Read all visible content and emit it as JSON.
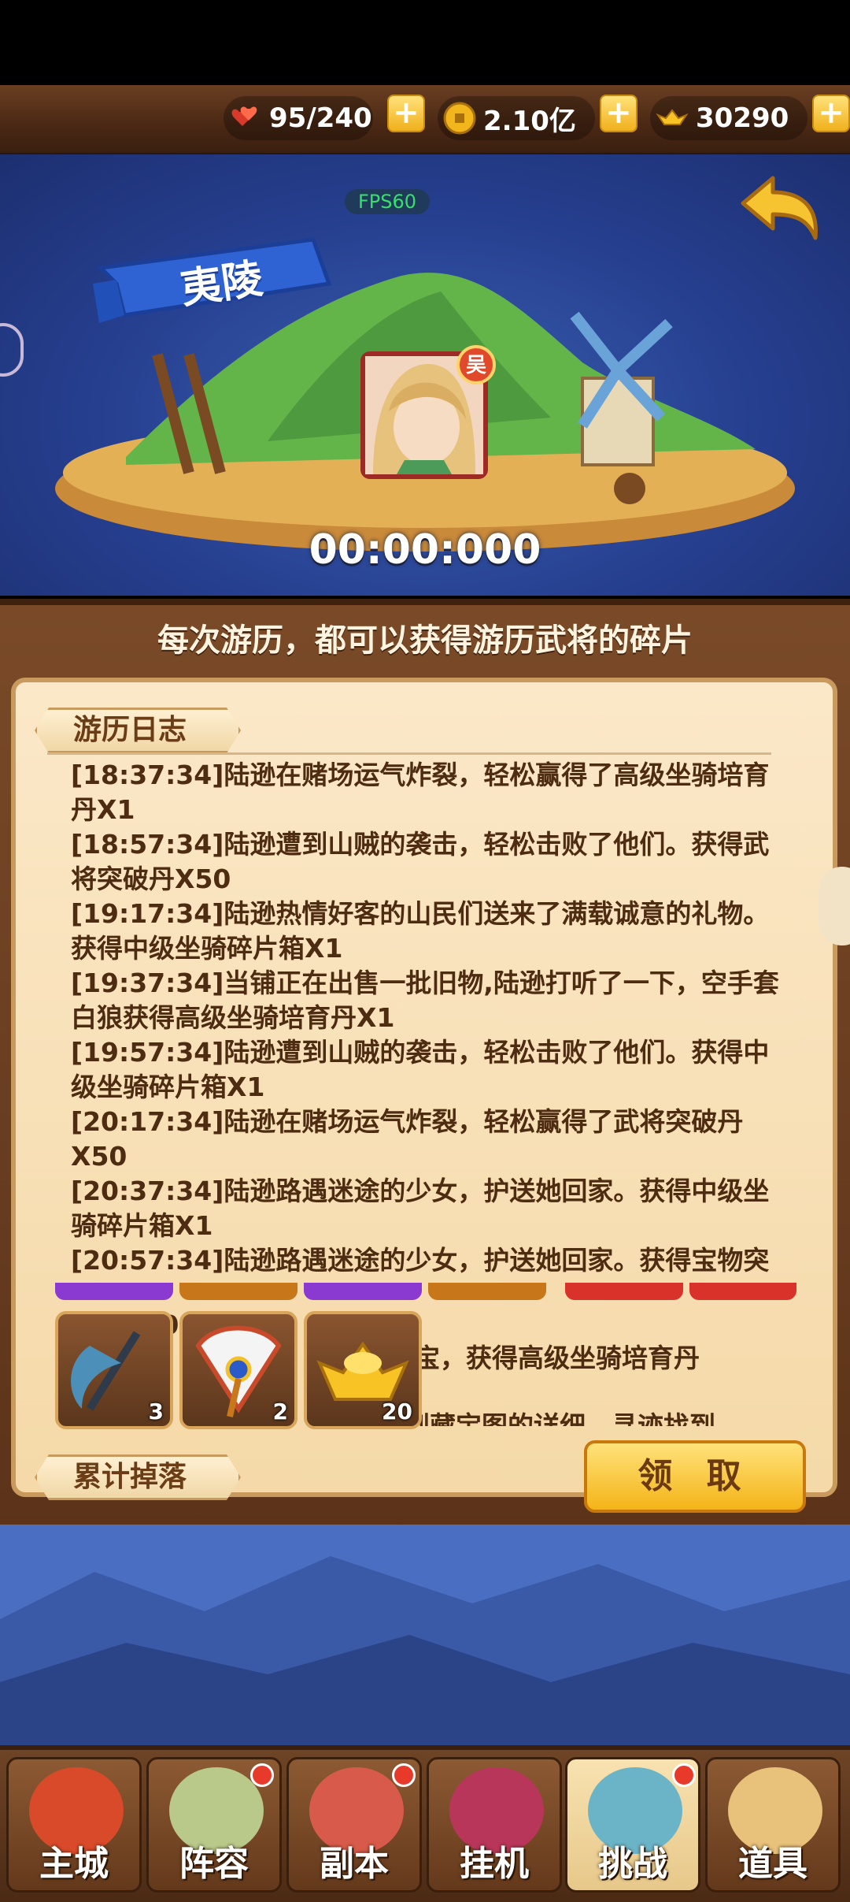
{
  "resources": {
    "stamina": {
      "icon": "hearts-icon",
      "value": "95/240"
    },
    "coins": {
      "icon": "coin-icon",
      "value": "2.10亿"
    },
    "gold": {
      "icon": "ingot-icon",
      "value": "30290"
    }
  },
  "scene": {
    "fps": "FPS60",
    "location": "夷陵",
    "hero_badge": "吴",
    "timer": "00:00:000"
  },
  "panel": {
    "header": "每次游历，都可以获得游历武将的碎片",
    "log_title": "游历日志",
    "drops_title": "累计掉落",
    "claim_label": "领 取"
  },
  "log": [
    "[18:37:34]陆逊在赌场运气炸裂，轻松赢得了高级坐骑培育丹X1",
    "[18:57:34]陆逊遭到山贼的袭击，轻松击败了他们。获得武将突破丹X50",
    "[19:17:34]陆逊热情好客的山民们送来了满载诚意的礼物。获得中级坐骑碎片箱X1",
    "[19:37:34]当铺正在出售一批旧物,陆逊打听了一下，空手套白狼获得高级坐骑培育丹X1",
    "[19:57:34]陆逊遭到山贼的袭击，轻松击败了他们。获得中级坐骑碎片箱X1",
    "[20:17:34]陆逊在赌场运气炸裂，轻松赢得了武将突破丹X50",
    "[20:37:34]陆逊路遇迷途的少女，护送她回家。获得中级坐骑碎片箱X1",
    "[20:57:34]陆逊路遇迷途的少女，护送她回家。获得宝物突"
  ],
  "log_partial": [
    "破石X10",
    "的藏宝，获得高级坐骑培育丹",
    "听到藏宝图的详细，寻迹找到"
  ],
  "drops": [
    {
      "icon": "scythe-icon",
      "count": "3"
    },
    {
      "icon": "feather-fan-icon",
      "count": "2"
    },
    {
      "icon": "gold-ingot-icon",
      "count": "20"
    }
  ],
  "nav": [
    {
      "label": "主城",
      "icon": "city-gate-icon",
      "dot": false,
      "active": false
    },
    {
      "label": "阵容",
      "icon": "formation-icon",
      "dot": true,
      "active": false
    },
    {
      "label": "副本",
      "icon": "dungeon-icon",
      "dot": true,
      "active": false
    },
    {
      "label": "挂机",
      "icon": "idle-icon",
      "dot": false,
      "active": false
    },
    {
      "label": "挑战",
      "icon": "challenge-icon",
      "dot": true,
      "active": true
    },
    {
      "label": "道具",
      "icon": "items-icon",
      "dot": false,
      "active": false
    }
  ]
}
